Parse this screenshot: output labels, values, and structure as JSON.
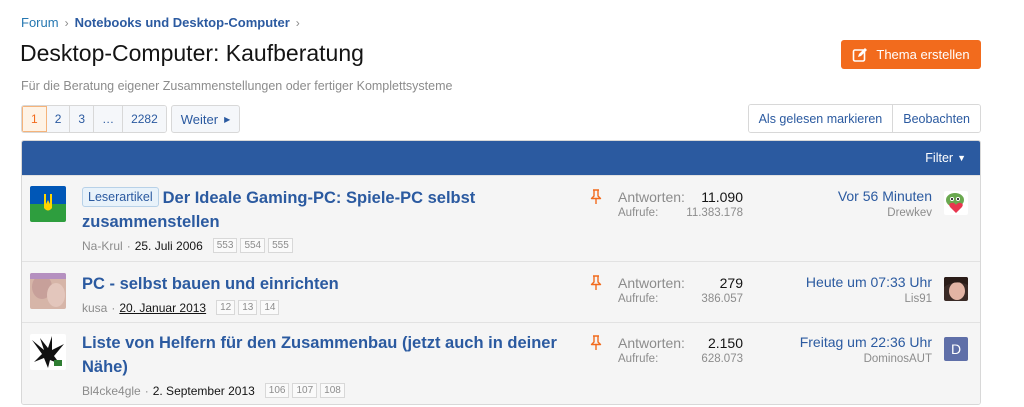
{
  "breadcrumb": {
    "items": [
      "Forum",
      "Notebooks und Desktop-Computer"
    ]
  },
  "page": {
    "title": "Desktop-Computer: Kaufberatung",
    "description": "Für die Beratung eigener Zusammenstellungen oder fertiger Komplettsysteme"
  },
  "create_button": {
    "label": "Thema erstellen",
    "icon": "pen-square-icon"
  },
  "pagination": {
    "pages": [
      "1",
      "2",
      "3",
      "…",
      "2282"
    ],
    "current": "1",
    "next_label": "Weiter"
  },
  "actions": {
    "mark_read": "Als gelesen markieren",
    "watch": "Beobachten"
  },
  "list_header": {
    "filter_label": "Filter"
  },
  "threads": [
    {
      "label": "Leserartikel",
      "title": "Der Ideale Gaming-PC: Spiele-PC selbst zusammenstellen",
      "author": "Na-Krul",
      "date": "25. Juli 2006",
      "pages": [
        "553",
        "554",
        "555"
      ],
      "replies_label": "Antworten:",
      "replies": "11.090",
      "views_label": "Aufrufe:",
      "views": "11.383.178",
      "last_time": "Vor 56 Minuten",
      "last_user": "Drewkev",
      "avatar_icon": "ukraine-flag-avatar",
      "last_avatar_icon": "frog-heart-avatar"
    },
    {
      "label": "",
      "title": "PC - selbst bauen und einrichten",
      "author": "kusa",
      "date": "20. Januar 2013",
      "pages": [
        "12",
        "13",
        "14"
      ],
      "replies_label": "Antworten:",
      "replies": "279",
      "views_label": "Aufrufe:",
      "views": "386.057",
      "last_time": "Heute um 07:33 Uhr",
      "last_user": "Lis91",
      "avatar_icon": "photo-avatar",
      "last_avatar_icon": "face-photo-avatar"
    },
    {
      "label": "",
      "title": "Liste von Helfern für den Zusammenbau (jetzt auch in deiner Nähe)",
      "author": "Bl4cke4gle",
      "date": "2. September 2013",
      "pages": [
        "106",
        "107",
        "108"
      ],
      "replies_label": "Antworten:",
      "replies": "2.150",
      "views_label": "Aufrufe:",
      "views": "628.073",
      "last_time": "Freitag um 22:36 Uhr",
      "last_user": "DominosAUT",
      "avatar_icon": "black-eagle-avatar",
      "last_avatar_letter": "D"
    }
  ],
  "colors": {
    "accent": "#f26b1d",
    "header_bar": "#2b5aa0",
    "link": "#2b5aa0",
    "muted": "#8c8c8c",
    "row_bg": "#f5f5f5"
  }
}
